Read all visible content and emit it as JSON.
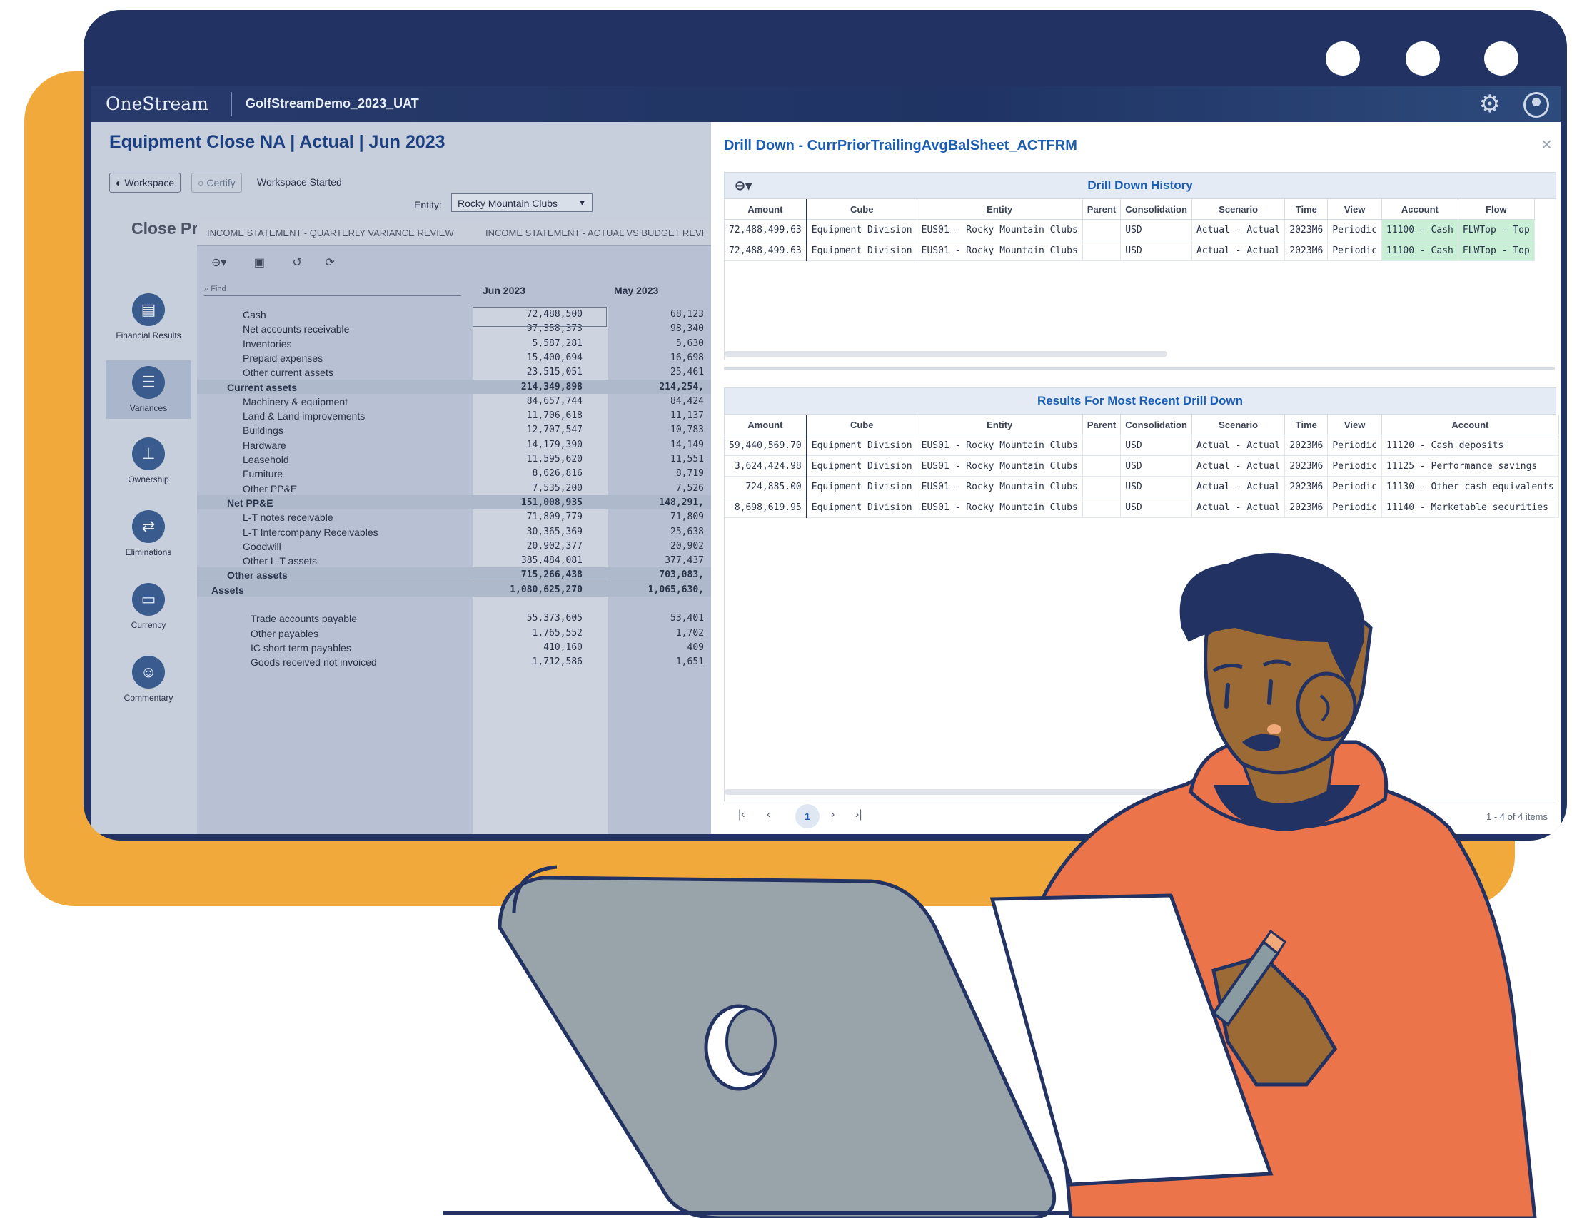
{
  "app": {
    "logo": "OneStream",
    "name": "GolfStreamDemo_2023_UAT"
  },
  "workspace": {
    "title": "Equipment Close NA | Actual | Jun 2023",
    "workspace_btn": "Workspace",
    "certify_btn": "Certify",
    "status": "Workspace Started",
    "entity_label": "Entity:",
    "entity_value": "Rocky Mountain Clubs",
    "section_title": "Close Process Review"
  },
  "sidebar": {
    "items": [
      {
        "label": "Financial Results"
      },
      {
        "label": "Variances"
      },
      {
        "label": "Ownership"
      },
      {
        "label": "Eliminations"
      },
      {
        "label": "Currency"
      },
      {
        "label": "Commentary"
      }
    ]
  },
  "grid": {
    "tabs": [
      "INCOME STATEMENT - QUARTERLY VARIANCE REVIEW",
      "INCOME STATEMENT - ACTUAL VS BUDGET REVI"
    ],
    "find_placeholder": "Find",
    "columns": [
      "Jun 2023",
      "May 2023"
    ],
    "rows": [
      {
        "label": "Cash",
        "jun": "72,488,500",
        "may": "68,123",
        "indent": 2
      },
      {
        "label": "Net accounts receivable",
        "jun": "97,358,373",
        "may": "98,340",
        "indent": 2
      },
      {
        "label": "Inventories",
        "jun": "5,587,281",
        "may": "5,630",
        "indent": 2
      },
      {
        "label": "Prepaid expenses",
        "jun": "15,400,694",
        "may": "16,698",
        "indent": 2
      },
      {
        "label": "Other current assets",
        "jun": "23,515,051",
        "may": "25,461",
        "indent": 2
      },
      {
        "label": "Current assets",
        "jun": "214,349,898",
        "may": "214,254,",
        "indent": 1,
        "bold": true
      },
      {
        "label": "Machinery & equipment",
        "jun": "84,657,744",
        "may": "84,424",
        "indent": 2
      },
      {
        "label": "Land & Land improvements",
        "jun": "11,706,618",
        "may": "11,137",
        "indent": 2
      },
      {
        "label": "Buildings",
        "jun": "12,707,547",
        "may": "10,783",
        "indent": 2
      },
      {
        "label": "Hardware",
        "jun": "14,179,390",
        "may": "14,149",
        "indent": 2
      },
      {
        "label": "Leasehold",
        "jun": "11,595,620",
        "may": "11,551",
        "indent": 2
      },
      {
        "label": "Furniture",
        "jun": "8,626,816",
        "may": "8,719",
        "indent": 2
      },
      {
        "label": "Other PP&E",
        "jun": "7,535,200",
        "may": "7,526",
        "indent": 2
      },
      {
        "label": "Net PP&E",
        "jun": "151,008,935",
        "may": "148,291,",
        "indent": 1,
        "bold": true
      },
      {
        "label": "L-T notes receivable",
        "jun": "71,809,779",
        "may": "71,809",
        "indent": 2
      },
      {
        "label": "L-T Intercompany Receivables",
        "jun": "30,365,369",
        "may": "25,638",
        "indent": 2
      },
      {
        "label": "Goodwill",
        "jun": "20,902,377",
        "may": "20,902",
        "indent": 2
      },
      {
        "label": "Other L-T assets",
        "jun": "385,484,081",
        "may": "377,437",
        "indent": 2
      },
      {
        "label": "Other assets",
        "jun": "715,266,438",
        "may": "703,083,",
        "indent": 1,
        "bold": true
      },
      {
        "label": "Assets",
        "jun": "1,080,625,270",
        "may": "1,065,630,",
        "indent": 0,
        "bold": true
      },
      {
        "label": "",
        "jun": "",
        "may": "",
        "indent": 0
      },
      {
        "label": "Trade accounts payable",
        "jun": "55,373,605",
        "may": "53,401",
        "indent": 3
      },
      {
        "label": "Other payables",
        "jun": "1,765,552",
        "may": "1,702",
        "indent": 3
      },
      {
        "label": "IC short term payables",
        "jun": "410,160",
        "may": "409",
        "indent": 3
      },
      {
        "label": "Goods received not invoiced",
        "jun": "1,712,586",
        "may": "1,651",
        "indent": 3
      }
    ]
  },
  "drill": {
    "title": "Drill Down - CurrPriorTrailingAvgBalSheet_ACTFRM",
    "history_title": "Drill Down History",
    "recent_title": "Results For Most Recent Drill Down",
    "history_headers": [
      "Amount",
      "Cube",
      "Entity",
      "Parent",
      "Consolidation",
      "Scenario",
      "Time",
      "View",
      "Account",
      "Flow"
    ],
    "history_rows": [
      [
        "72,488,499.63",
        "Equipment Division",
        "EUS01 - Rocky Mountain Clubs",
        "",
        "USD",
        "Actual - Actual",
        "2023M6",
        "Periodic",
        "11100 - Cash",
        "FLWTop - Top"
      ],
      [
        "72,488,499.63",
        "Equipment Division",
        "EUS01 - Rocky Mountain Clubs",
        "",
        "USD",
        "Actual - Actual",
        "2023M6",
        "Periodic",
        "11100 - Cash",
        "FLWTop - Top"
      ]
    ],
    "recent_headers": [
      "Amount",
      "Cube",
      "Entity",
      "Parent",
      "Consolidation",
      "Scenario",
      "Time",
      "View",
      "Account"
    ],
    "recent_rows": [
      [
        "59,440,569.70",
        "Equipment Division",
        "EUS01 - Rocky Mountain Clubs",
        "",
        "USD",
        "Actual - Actual",
        "2023M6",
        "Periodic",
        "11120 - Cash deposits"
      ],
      [
        "3,624,424.98",
        "Equipment Division",
        "EUS01 - Rocky Mountain Clubs",
        "",
        "USD",
        "Actual - Actual",
        "2023M6",
        "Periodic",
        "11125 - Performance savings"
      ],
      [
        "724,885.00",
        "Equipment Division",
        "EUS01 - Rocky Mountain Clubs",
        "",
        "USD",
        "Actual - Actual",
        "2023M6",
        "Periodic",
        "11130 - Other cash equivalents"
      ],
      [
        "8,698,619.95",
        "Equipment Division",
        "EUS01 - Rocky Mountain Clubs",
        "",
        "USD",
        "Actual - Actual",
        "2023M6",
        "Periodic",
        "11140 - Marketable securities"
      ]
    ],
    "pager": {
      "current": "1",
      "summary": "1 - 4 of 4 items"
    }
  },
  "colors": {
    "frame": "#213263",
    "orange": "#f1a93b",
    "hoodie": "#ec744a",
    "skin": "#9c6a34",
    "laptop": "#98a3aa",
    "accent_blue": "#1b5db0"
  }
}
